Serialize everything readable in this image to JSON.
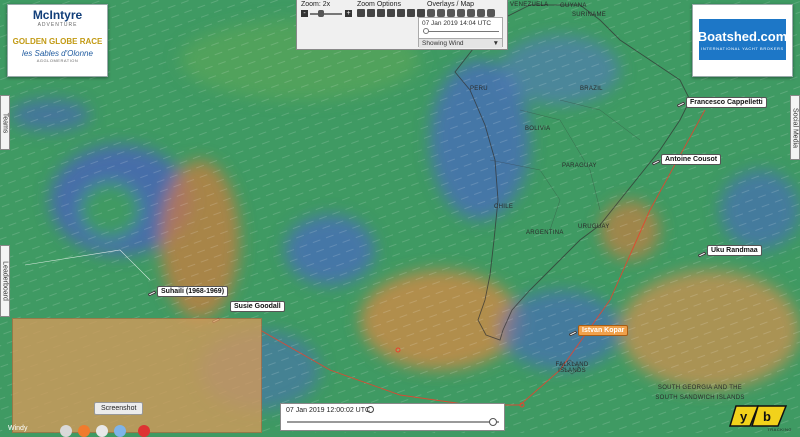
{
  "logo": {
    "line1": "McIntyre",
    "line2": "ADVENTURE",
    "line3": "GOLDEN GLOBE RACE",
    "line4": "les Sables d'Olonne",
    "line5": "AGGLOMERATION"
  },
  "sponsor": {
    "name": "Boatshed.com",
    "tagline": "INTERNATIONAL YACHT BROKERS"
  },
  "controls": {
    "zoom_label": "Zoom: 2x",
    "zoom_minus": "-",
    "zoom_plus": "+",
    "zoom_level": 0.3,
    "zoom_options_label": "Zoom Options",
    "overlays_label": "Overlays / Map",
    "timestamp": "07 Jan 2019 14:04 UTC",
    "overlay_select": "Showing Wind",
    "select_arrow": "▼"
  },
  "side_tabs": {
    "teams": "Teams",
    "leaderboard": "Leaderboard",
    "social_media": "Social Media"
  },
  "boats": [
    {
      "name": "Francesco Cappelletti",
      "highlight": false
    },
    {
      "name": "Antoine Cousot",
      "highlight": false
    },
    {
      "name": "Uku Randmaa",
      "highlight": false
    },
    {
      "name": "Istvan Kopar",
      "highlight": true
    },
    {
      "name": "Suhaili (1968-1969)",
      "highlight": false
    },
    {
      "name": "Susie Goodall",
      "highlight": false
    }
  ],
  "map_labels": {
    "guyana": "GUYANA",
    "suriname": "SURINAME",
    "venezuela": "VENEZUELA",
    "peru": "PERU",
    "brazil": "BRAZIL",
    "bolivia": "BOLIVIA",
    "paraguay": "PARAGUAY",
    "chile": "CHILE",
    "argentina": "ARGENTINA",
    "uruguay": "URUGUAY",
    "falklands": "FALKLAND ISLANDS",
    "south_georgia": "SOUTH GEORGIA AND THE SOUTH SANDWICH ISLANDS"
  },
  "screenshot_tip": "Screenshot",
  "bottom_slider": {
    "timestamp": "07 Jan 2019 12:00:02 UTC",
    "position": 0.97
  },
  "yb": {
    "text": "TRACKING"
  },
  "dock": {
    "windy": "Windy"
  },
  "colors": {
    "wind_base": "#3f9a63",
    "wind_calm_blue": "#4a68c4",
    "wind_strong_orange": "#d8904a",
    "route_red": "#e8432e",
    "highlight_orange": "#f0a04a"
  }
}
